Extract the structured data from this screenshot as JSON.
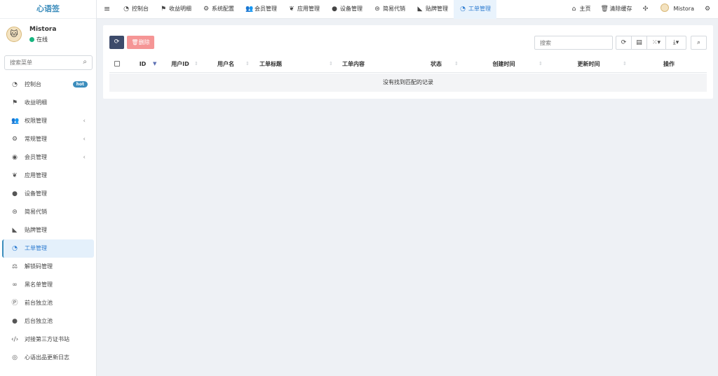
{
  "app": {
    "logo": "心语签"
  },
  "user": {
    "name": "Mistora",
    "status": "在线"
  },
  "sidebar": {
    "search_placeholder": "搜索菜单",
    "items": [
      {
        "label": "控制台",
        "badge": "hot",
        "icon": "dashboard-icon"
      },
      {
        "label": "收益明细",
        "icon": "flag-icon"
      },
      {
        "label": "权限管理",
        "icon": "users-icon",
        "expandable": true
      },
      {
        "label": "常规管理",
        "icon": "cogs-icon",
        "expandable": true
      },
      {
        "label": "会员管理",
        "icon": "user-circle-icon",
        "expandable": true
      },
      {
        "label": "应用管理",
        "icon": "leaf-icon"
      },
      {
        "label": "设备管理",
        "icon": "circle-icon"
      },
      {
        "label": "简易代销",
        "icon": "circle-dots-icon"
      },
      {
        "label": "贴牌管理",
        "icon": "tags-icon"
      },
      {
        "label": "工单管理",
        "icon": "dashboard-icon",
        "active": true
      },
      {
        "label": "解锁码管理",
        "icon": "balance-scale-icon"
      },
      {
        "label": "黑名单管理",
        "icon": "bicycle-icon"
      },
      {
        "label": "前台独立池",
        "icon": "product-hunt-icon"
      },
      {
        "label": "后台独立池",
        "icon": "apple-icon"
      },
      {
        "label": "对接第三方证书站",
        "icon": "code-icon"
      },
      {
        "label": "心语出品更新日志",
        "icon": "eye-icon"
      }
    ]
  },
  "topbar": {
    "tabs": [
      {
        "label": "控制台",
        "icon": "dashboard-icon"
      },
      {
        "label": "收益明细",
        "icon": "flag-icon"
      },
      {
        "label": "系统配置",
        "icon": "cog-icon"
      },
      {
        "label": "会员管理",
        "icon": "users-icon"
      },
      {
        "label": "应用管理",
        "icon": "leaf-icon"
      },
      {
        "label": "设备管理",
        "icon": "circle-icon"
      },
      {
        "label": "简易代销",
        "icon": "circle-dots-icon"
      },
      {
        "label": "贴牌管理",
        "icon": "tags-icon"
      },
      {
        "label": "工单管理",
        "icon": "dashboard-icon",
        "active": true
      }
    ],
    "home": "主页",
    "clear_cache": "清除缓存",
    "username": "Mistora"
  },
  "toolbar": {
    "delete_label": "删除",
    "search_placeholder": "搜索"
  },
  "table": {
    "columns": [
      "ID",
      "用户ID",
      "用户名",
      "工单标题",
      "工单内容",
      "状态",
      "创建时间",
      "更新时间",
      "操作"
    ],
    "empty_text": "没有找到匹配的记录"
  },
  "colors": {
    "accent": "#3c8dbc",
    "active_text": "#2f7dd1",
    "delete": "#f59595",
    "refresh": "#3d4b6b",
    "online": "#16b57f"
  }
}
